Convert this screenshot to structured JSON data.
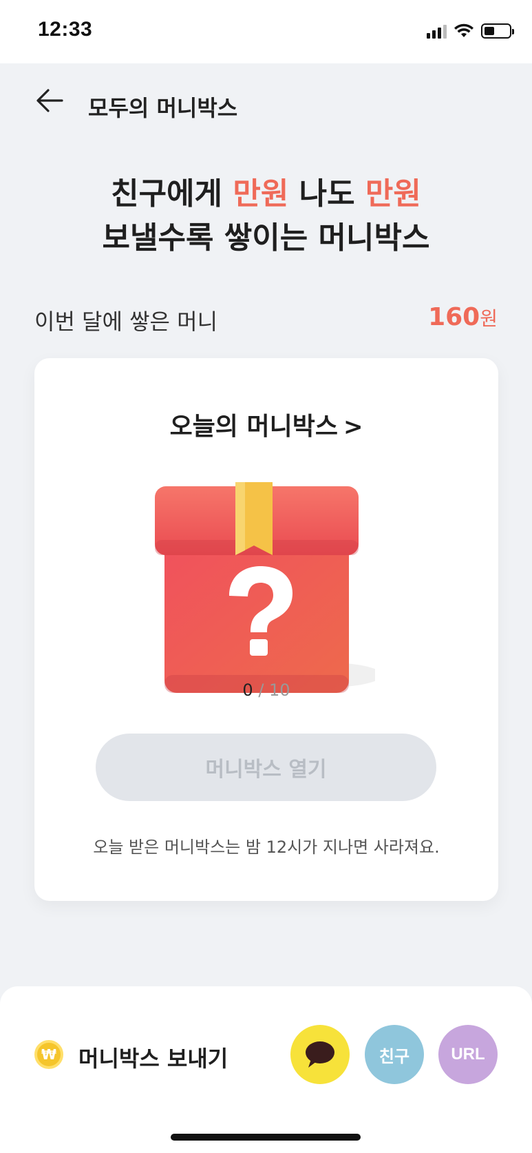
{
  "status_bar": {
    "time": "12:33",
    "battery_level": 0.4
  },
  "header": {
    "title": "모두의 머니박스",
    "back_icon": "arrow-left-icon"
  },
  "headline": {
    "line1_part1": "친구에게 ",
    "line1_accent1": "만원",
    "line1_part2": " 나도 ",
    "line1_accent2": "만원",
    "line2": "보낼수록 쌓이는 머니박스"
  },
  "monthly": {
    "label": "이번 달에 쌓은 머니",
    "amount": "160",
    "unit": "원"
  },
  "moneybox_card": {
    "title": "오늘의 머니박스",
    "chevron": ">",
    "gift_icon": "mystery-gift-box-icon",
    "count_current": "0",
    "count_separator": " / ",
    "count_total": "10",
    "open_button_label": "머니박스 열기",
    "note": "오늘 받은 머니박스는 밤 12시가 지나면 사라져요."
  },
  "bottom_bar": {
    "coin_symbol": "₩",
    "label": "머니박스 보내기",
    "share_buttons": {
      "kakao_icon": "speech-bubble-icon",
      "friend_label": "친구",
      "url_label": "URL"
    }
  },
  "colors": {
    "accent": "#ef6a58",
    "background": "#f0f2f5",
    "disabled_button": "#e2e5ea",
    "kakao": "#f7e23a",
    "friend": "#8fc6dc",
    "url": "#c7a6dd"
  }
}
